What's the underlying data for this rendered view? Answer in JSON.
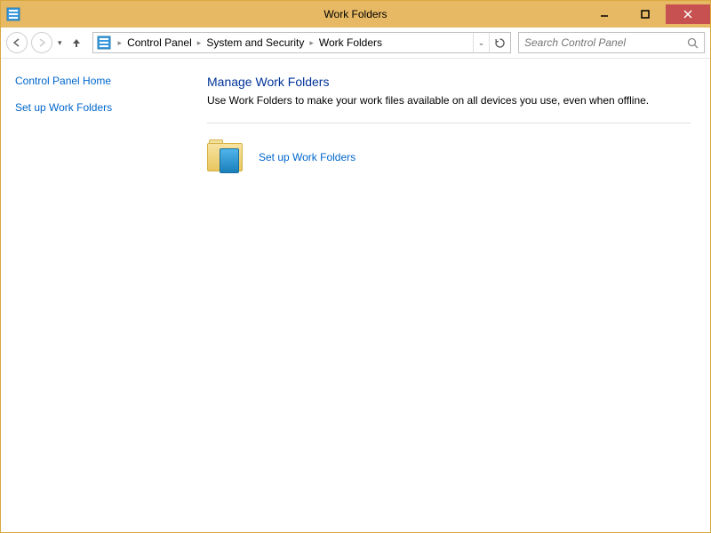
{
  "window": {
    "title": "Work Folders"
  },
  "breadcrumb": {
    "items": [
      "Control Panel",
      "System and Security",
      "Work Folders"
    ]
  },
  "search": {
    "placeholder": "Search Control Panel"
  },
  "sidebar": {
    "home_label": "Control Panel Home",
    "setup_label": "Set up Work Folders"
  },
  "main": {
    "heading": "Manage Work Folders",
    "description": "Use Work Folders to make your work files available on all devices you use, even when offline.",
    "setup_link": "Set up Work Folders"
  }
}
